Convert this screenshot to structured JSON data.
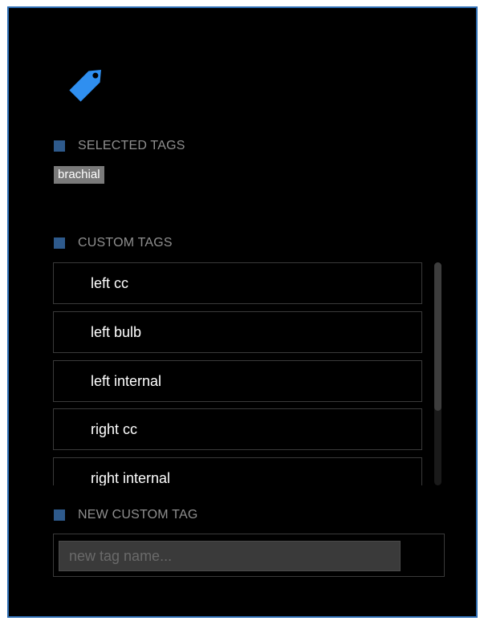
{
  "header": {
    "icon": "tag-icon",
    "icon_color": "#2f8ff0"
  },
  "selected_tags": {
    "label": "SELECTED TAGS",
    "tags": [
      "brachial"
    ]
  },
  "custom_tags": {
    "label": "CUSTOM TAGS",
    "items": [
      "left cc",
      "left bulb",
      "left internal",
      "right cc",
      "right internal"
    ]
  },
  "new_custom_tag": {
    "label": "NEW CUSTOM TAG",
    "placeholder": "new tag name...",
    "value": ""
  },
  "colors": {
    "panel_border": "#2f6fb5",
    "section_marker": "#2e5a8c",
    "chip_background": "#7a7a7a"
  }
}
